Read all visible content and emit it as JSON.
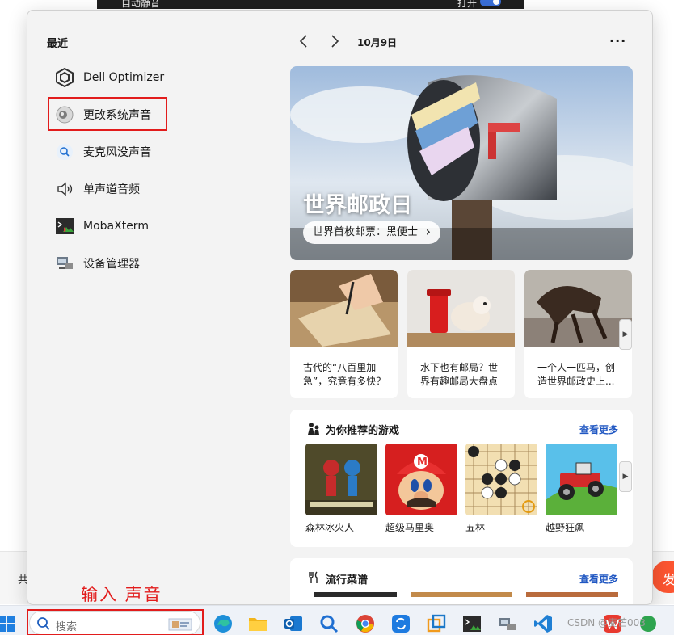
{
  "background": {
    "top_left_label": "自动静音",
    "top_right_label": "打开",
    "strip_label": "共",
    "side_button": "发"
  },
  "flyout": {
    "recent": {
      "title": "最近",
      "items": [
        {
          "label": "Dell Optimizer",
          "icon": "dell-optimizer-icon"
        },
        {
          "label": "更改系统声音",
          "icon": "speaker-sound-icon"
        },
        {
          "label": "麦克风没声音",
          "icon": "search-result-icon"
        },
        {
          "label": "单声道音频",
          "icon": "volume-icon"
        },
        {
          "label": "MobaXterm",
          "icon": "mobaxterm-icon"
        },
        {
          "label": "设备管理器",
          "icon": "device-manager-icon"
        }
      ]
    },
    "nav": {
      "date": "10月9日",
      "more": "···"
    },
    "hero": {
      "title": "世界邮政日",
      "pill": "世界首枚邮票：黑便士"
    },
    "cards": [
      {
        "caption": "古代的“八百里加急”，究竟有多快？"
      },
      {
        "caption": "水下也有邮局？世界有趣邮局大盘点"
      },
      {
        "caption": "一个人一匹马，创造世界邮政史上..."
      }
    ],
    "games": {
      "title": "为你推荐的游戏",
      "more": "查看更多",
      "items": [
        {
          "label": "森林冰火人"
        },
        {
          "label": "超级马里奥"
        },
        {
          "label": "五林"
        },
        {
          "label": "越野狂飙"
        }
      ]
    },
    "recipes": {
      "title": "流行菜谱",
      "more": "查看更多"
    }
  },
  "annotation": "输入 声音",
  "taskbar": {
    "search_placeholder": "搜索",
    "watermark": "CSDN @麦芒003"
  },
  "colors": {
    "highlight": "#e21c1c",
    "link": "#2057c2",
    "accent": "#3a6fd8"
  }
}
